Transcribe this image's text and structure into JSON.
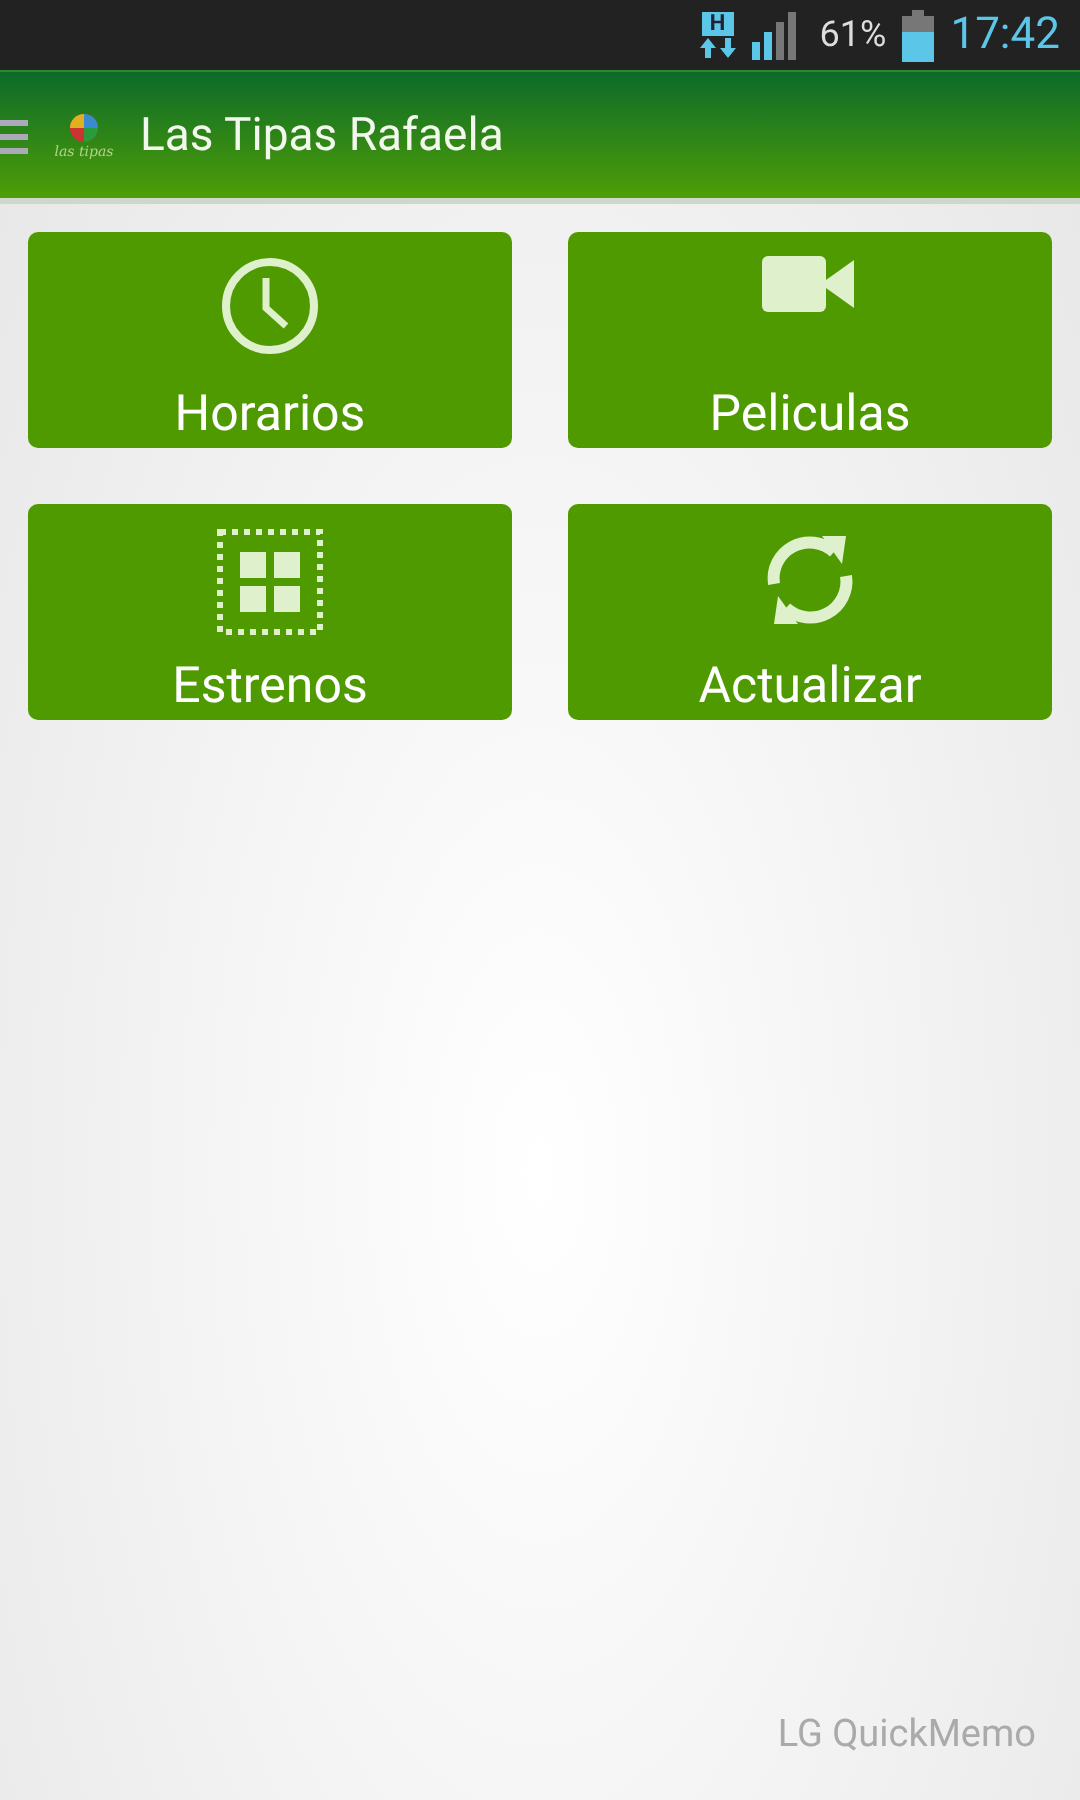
{
  "status_bar": {
    "network": "H",
    "battery": "61%",
    "time": "17:42"
  },
  "app_bar": {
    "logo_text": "las tipas",
    "title": "Las Tipas Rafaela"
  },
  "tiles": [
    {
      "kind": "clock",
      "label": "Horarios"
    },
    {
      "kind": "video",
      "label": "Peliculas"
    },
    {
      "kind": "grid",
      "label": "Estrenos"
    },
    {
      "kind": "refresh",
      "label": "Actualizar"
    }
  ],
  "overlay": {
    "text": "LG QuickMemo"
  }
}
